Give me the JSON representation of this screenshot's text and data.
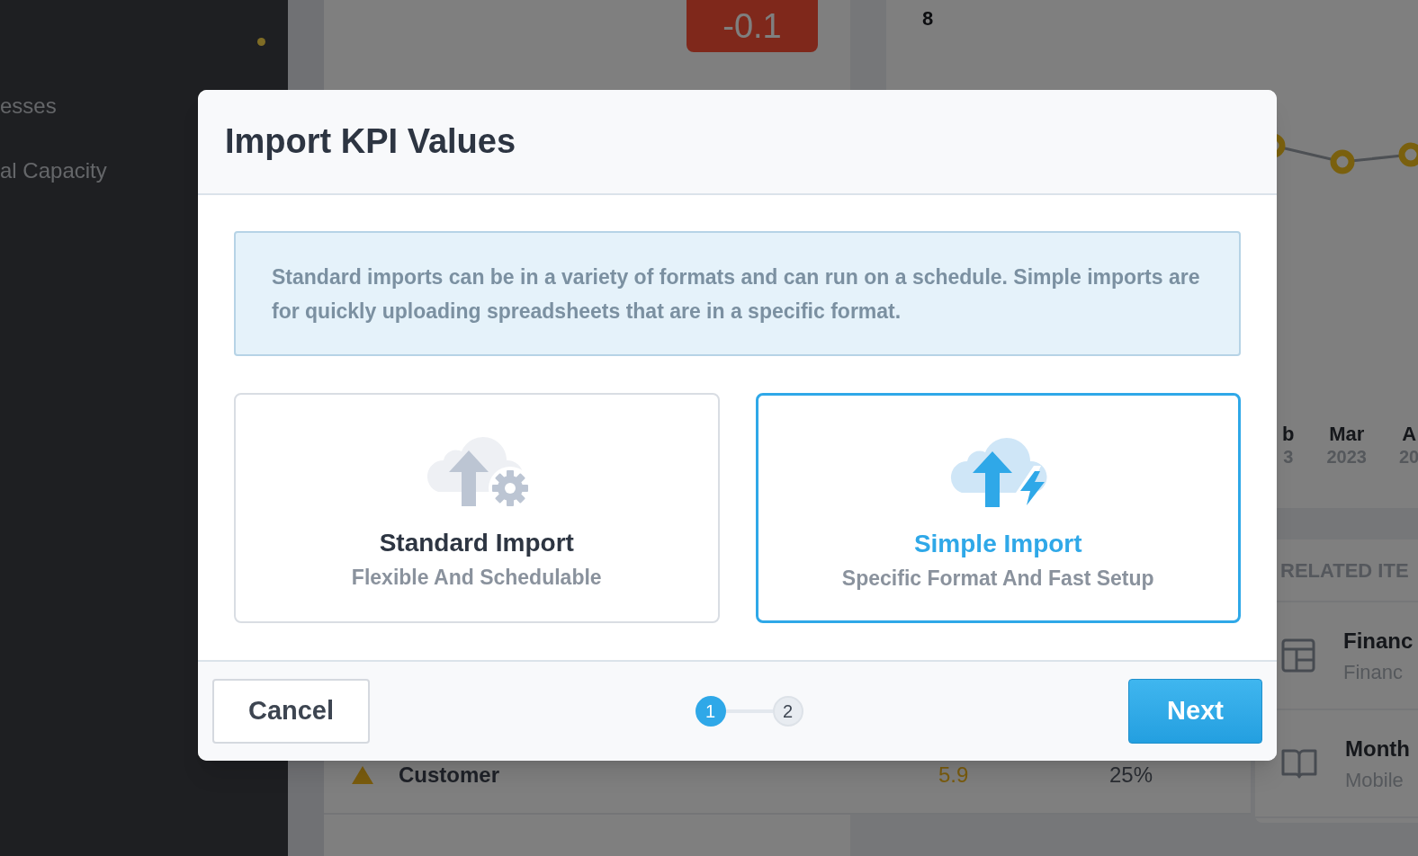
{
  "sidebar": {
    "items": [
      {
        "label": "esses"
      },
      {
        "label": "al Capacity"
      }
    ]
  },
  "score_badge": "-0.1",
  "table": {
    "rows": [
      {
        "name": "Customer",
        "value": "5.9",
        "weight": "25%"
      }
    ]
  },
  "chart": {
    "y_tick": "8",
    "x_labels": [
      {
        "month": "b",
        "year": "3"
      },
      {
        "month": "Mar",
        "year": "2023"
      },
      {
        "month": "A",
        "year": "20"
      }
    ]
  },
  "related": {
    "title": "RELATED ITE",
    "items": [
      {
        "kind": "table",
        "title": "Financ",
        "subtitle": "Financ"
      },
      {
        "kind": "book",
        "title": "Month",
        "subtitle": "Mobile"
      }
    ]
  },
  "dialog": {
    "title": "Import KPI Values",
    "info": "Standard imports can be in a variety of formats and can run on a schedule. Simple imports are for quickly uploading spreadsheets that are in a specific format.",
    "options": [
      {
        "kind": "standard",
        "title": "Standard Import",
        "subtitle": "Flexible And Schedulable",
        "selected": false
      },
      {
        "kind": "simple",
        "title": "Simple Import",
        "subtitle": "Specific Format And Fast Setup",
        "selected": true
      }
    ],
    "steps": [
      {
        "label": "1",
        "selected": true
      },
      {
        "label": "2",
        "selected": false
      }
    ],
    "cancel": "Cancel",
    "next": "Next"
  }
}
